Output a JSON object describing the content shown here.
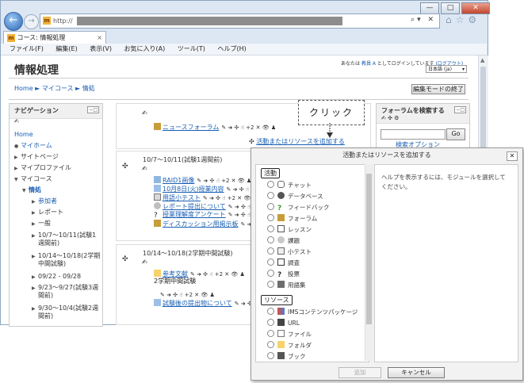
{
  "browser": {
    "url_prefix": "http://",
    "tab_title": "コース: 情報処理",
    "menu": [
      "ファイル(F)",
      "編集(E)",
      "表示(V)",
      "お気に入り(A)",
      "ツール(T)",
      "ヘルプ(H)"
    ],
    "window_buttons": [
      "—",
      "□",
      "✕"
    ]
  },
  "header": {
    "site_title": "情報処理",
    "login_prefix": "あなたは",
    "login_user": "教員 A",
    "login_suffix": "としてログインしています",
    "logout": "(ログアウト)",
    "language": "日本語 (ja)"
  },
  "breadcrumb": "Home ► マイコース ► 情処",
  "edit_mode_button": "編集モードの終了",
  "navigation": {
    "title": "ナビゲーション",
    "items": [
      {
        "label": "Home"
      },
      {
        "label": "マイホーム"
      },
      {
        "label": "サイトページ"
      },
      {
        "label": "マイプロファイル"
      },
      {
        "label": "マイコース"
      },
      {
        "label": "情処"
      },
      {
        "label": "参加者"
      },
      {
        "label": "レポート"
      },
      {
        "label": "一般"
      },
      {
        "label": "10/7～10/11(試験1"
      },
      {
        "label": "週間前)"
      },
      {
        "label": "10/14～10/18(2学期"
      },
      {
        "label": "中間試験)"
      },
      {
        "label": "09/22 - 09/28"
      },
      {
        "label": "9/23～9/27(試験3週"
      },
      {
        "label": "間前)"
      },
      {
        "label": "9/30～10/4(試験2週"
      },
      {
        "label": "間前)"
      }
    ]
  },
  "search_block": {
    "title": "フォーラムを検索する",
    "go": "Go",
    "advanced": "検索オプション"
  },
  "callout": "クリック",
  "sections": {
    "top": {
      "forum": "ニュースフォーラム",
      "add_link": "活動またはリソースを追加する"
    },
    "week1": {
      "title": "10/7～10/11(試験1週間前)",
      "activities": [
        "RAID1画像",
        "10月8日(火)授業内容",
        "用語小テスト",
        "レポート提出について",
        "授業理解度アンケート",
        "ディスカッション用掲示板"
      ]
    },
    "week2": {
      "title": "10/14～10/18(2学期中間試験)",
      "activities": [
        "参考文献",
        "2学期中間試験",
        "試験後の提出物について"
      ]
    }
  },
  "edit_icons": "✎ ➜ ✣ ☝ +2 ✕ 👁 ♟",
  "dialog": {
    "title": "活動またはリソースを追加する",
    "help_text": "ヘルプを表示するには、モジュールを選択してください。",
    "activities_label": "活動",
    "activities": [
      "チャット",
      "データベース",
      "フィードバック",
      "フォーラム",
      "レッスン",
      "課題",
      "小テスト",
      "調査",
      "投票",
      "用語集"
    ],
    "resources_label": "リソース",
    "resources": [
      "IMSコンテンツパッケージ",
      "URL",
      "ファイル",
      "フォルダ",
      "ブック"
    ],
    "add_button": "追加",
    "cancel_button": "キャンセル"
  },
  "colors": {
    "link": "#1a5fb4",
    "accent": "#f2b23a"
  }
}
